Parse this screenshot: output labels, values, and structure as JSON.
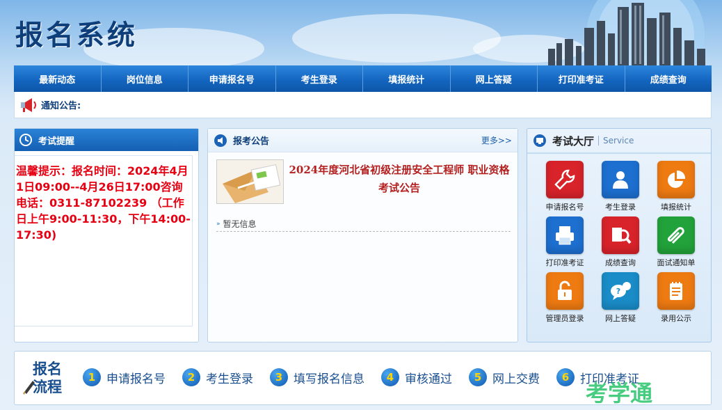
{
  "header": {
    "title": "报名系统"
  },
  "nav": {
    "items": [
      {
        "label": "最新动态"
      },
      {
        "label": "岗位信息"
      },
      {
        "label": "申请报名号"
      },
      {
        "label": "考生登录"
      },
      {
        "label": "填报统计"
      },
      {
        "label": "网上答疑"
      },
      {
        "label": "打印准考证"
      },
      {
        "label": "成绩查询"
      }
    ]
  },
  "notice": {
    "label": "通知公告:"
  },
  "reminder": {
    "title": "考试提醒",
    "text": "温馨提示：报名时间：2024年4月1日09:00--4月26日17:00咨询电话：0311-87102239 （工作日上午9:00-11:30，下午14:00-17:30)"
  },
  "announcements": {
    "title": "报考公告",
    "more": "更多>>",
    "headline": "2024年度河北省初级注册安全工程师 职业资格考试公告",
    "empty": "暂无信息"
  },
  "hall": {
    "title": "考试大厅",
    "subtitle": "Service",
    "tiles": [
      {
        "label": "申请报名号",
        "color": "#d8232a",
        "icon": "wrench-icon"
      },
      {
        "label": "考生登录",
        "color": "#1d6fd0",
        "icon": "user-icon"
      },
      {
        "label": "填报统计",
        "color": "#ee7a12",
        "icon": "pie-chart-icon"
      },
      {
        "label": "打印准考证",
        "color": "#1d6fd0",
        "icon": "printer-icon"
      },
      {
        "label": "成绩查询",
        "color": "#d8232a",
        "icon": "magnifier-icon"
      },
      {
        "label": "面试通知单",
        "color": "#22a23a",
        "icon": "paperclip-icon"
      },
      {
        "label": "管理员登录",
        "color": "#ee7a12",
        "icon": "padlock-icon"
      },
      {
        "label": "网上答疑",
        "color": "#1a8cc8",
        "icon": "question-bubble-icon"
      },
      {
        "label": "录用公示",
        "color": "#ee7a12",
        "icon": "notepad-icon"
      }
    ]
  },
  "flow": {
    "title_line1": "报名",
    "title_line2": "流程",
    "steps": [
      {
        "num": "1",
        "label": "申请报名号"
      },
      {
        "num": "2",
        "label": "考生登录"
      },
      {
        "num": "3",
        "label": "填写报名信息"
      },
      {
        "num": "4",
        "label": "审核通过"
      },
      {
        "num": "5",
        "label": "网上交费"
      },
      {
        "num": "6",
        "label": "打印准考证"
      }
    ]
  },
  "watermark": {
    "text": "考学通"
  }
}
